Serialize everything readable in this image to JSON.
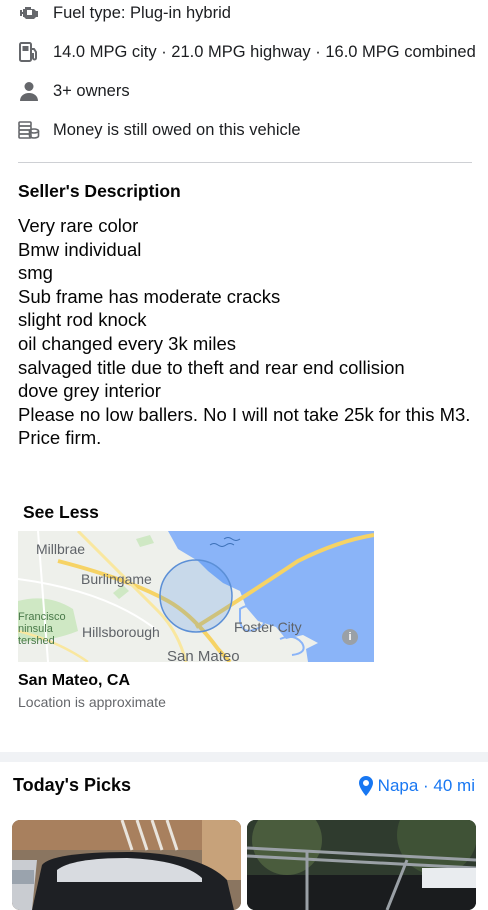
{
  "features": [
    {
      "icon": "engine-icon",
      "text": "Fuel type: Plug-in hybrid"
    },
    {
      "icon": "fuel-pump-icon",
      "text": "14.0 MPG city · 21.0 MPG highway · 16.0 MPG combined"
    },
    {
      "icon": "person-icon",
      "text": "3+ owners"
    },
    {
      "icon": "money-stack-icon",
      "text": "Money is still owed on this vehicle"
    }
  ],
  "seller": {
    "heading": "Seller's Description",
    "lines": [
      "Very rare color",
      "Bmw individual",
      "smg",
      "Sub frame has moderate cracks",
      "slight rod knock",
      "oil changed every 3k miles",
      "salvaged title due to theft and rear end collision",
      "dove grey interior",
      "Please no low ballers. No I will not take 25k for this M3.",
      "Price firm."
    ],
    "toggle": "See Less"
  },
  "map": {
    "labels": {
      "millbrae": "Millbrae",
      "burlingame": "Burlingame",
      "sf_1": "Francisco",
      "sf_2": "ninsula",
      "sf_3": "tershed",
      "hillsborough": "Hillsborough",
      "foster_city": "Foster City",
      "san_mateo": "San Mateo"
    },
    "info_icon": "info-icon"
  },
  "location": {
    "city": "San Mateo, CA",
    "note": "Location is approximate"
  },
  "picks": {
    "title": "Today's Picks",
    "location": "Napa · 40 mi",
    "location_icon": "location-pin-icon"
  },
  "colors": {
    "accent": "#1877f2",
    "water": "#8ab4f8",
    "highway": "#f6d365"
  }
}
